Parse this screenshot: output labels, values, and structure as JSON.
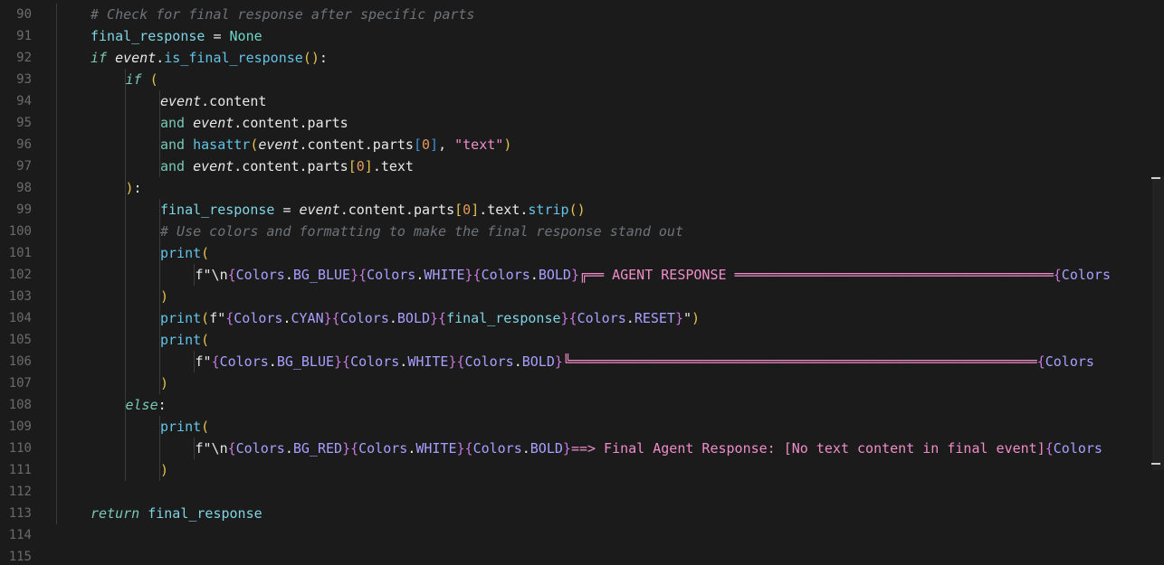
{
  "editor": {
    "lines": [
      {
        "num": "90",
        "indent": 1,
        "tokens": [
          [
            "comment",
            "# Check for final response after specific parts"
          ]
        ]
      },
      {
        "num": "91",
        "indent": 1,
        "tokens": [
          [
            "var",
            "final_response"
          ],
          [
            "op",
            " = "
          ],
          [
            "bool",
            "None"
          ]
        ]
      },
      {
        "num": "92",
        "indent": 1,
        "tokens": [
          [
            "kw",
            "if"
          ],
          [
            "op",
            " "
          ],
          [
            "it",
            "event"
          ],
          [
            "op",
            "."
          ],
          [
            "func",
            "is_final_response"
          ],
          [
            "paren",
            "()"
          ],
          [
            "op",
            ":"
          ]
        ]
      },
      {
        "num": "93",
        "indent": 2,
        "tokens": [
          [
            "kw",
            "if"
          ],
          [
            "op",
            " "
          ],
          [
            "paren",
            "("
          ]
        ]
      },
      {
        "num": "94",
        "indent": 3,
        "tokens": [
          [
            "it",
            "event"
          ],
          [
            "op",
            ".content"
          ]
        ]
      },
      {
        "num": "95",
        "indent": 3,
        "tokens": [
          [
            "kwp",
            "and"
          ],
          [
            "op",
            " "
          ],
          [
            "it",
            "event"
          ],
          [
            "op",
            ".content.parts"
          ]
        ]
      },
      {
        "num": "96",
        "indent": 3,
        "tokens": [
          [
            "kwp",
            "and"
          ],
          [
            "op",
            " "
          ],
          [
            "func",
            "hasattr"
          ],
          [
            "paren",
            "("
          ],
          [
            "it",
            "event"
          ],
          [
            "op",
            ".content.parts"
          ],
          [
            "bracket",
            "["
          ],
          [
            "num",
            "0"
          ],
          [
            "bracket",
            "]"
          ],
          [
            "op",
            ", "
          ],
          [
            "str",
            "\"text\""
          ],
          [
            "paren",
            ")"
          ]
        ]
      },
      {
        "num": "97",
        "indent": 3,
        "tokens": [
          [
            "kwp",
            "and"
          ],
          [
            "op",
            " "
          ],
          [
            "it",
            "event"
          ],
          [
            "op",
            ".content.parts"
          ],
          [
            "paren",
            "["
          ],
          [
            "num",
            "0"
          ],
          [
            "paren",
            "]"
          ],
          [
            "op",
            ".text"
          ]
        ]
      },
      {
        "num": "98",
        "indent": 2,
        "tokens": [
          [
            "paren",
            ")"
          ],
          [
            "op",
            ":"
          ]
        ]
      },
      {
        "num": "99",
        "indent": 3,
        "tokens": [
          [
            "var",
            "final_response"
          ],
          [
            "op",
            " = "
          ],
          [
            "it",
            "event"
          ],
          [
            "op",
            ".content.parts"
          ],
          [
            "paren",
            "["
          ],
          [
            "num",
            "0"
          ],
          [
            "paren",
            "]"
          ],
          [
            "op",
            ".text."
          ],
          [
            "func",
            "strip"
          ],
          [
            "paren",
            "()"
          ]
        ]
      },
      {
        "num": "100",
        "indent": 3,
        "tokens": [
          [
            "comment",
            "# Use colors and formatting to make the final response stand out"
          ]
        ]
      },
      {
        "num": "101",
        "indent": 3,
        "tokens": [
          [
            "func",
            "print"
          ],
          [
            "paren",
            "("
          ]
        ]
      },
      {
        "num": "102",
        "indent": 4,
        "tokens": [
          [
            "op",
            "f\"\\n"
          ],
          [
            "brace",
            "{"
          ],
          [
            "cls",
            "Colors"
          ],
          [
            "op",
            "."
          ],
          [
            "cls",
            "BG_BLUE"
          ],
          [
            "brace",
            "}{"
          ],
          [
            "cls",
            "Colors"
          ],
          [
            "op",
            "."
          ],
          [
            "cls",
            "WHITE"
          ],
          [
            "brace",
            "}{"
          ],
          [
            "cls",
            "Colors"
          ],
          [
            "op",
            "."
          ],
          [
            "cls",
            "BOLD"
          ],
          [
            "brace",
            "}"
          ],
          [
            "str",
            "╔══ AGENT RESPONSE ═══════════════════════════════════════"
          ],
          [
            "brace",
            "{"
          ],
          [
            "cls",
            "Colors"
          ]
        ]
      },
      {
        "num": "103",
        "indent": 3,
        "tokens": [
          [
            "paren",
            ")"
          ]
        ]
      },
      {
        "num": "104",
        "indent": 3,
        "tokens": [
          [
            "func",
            "print"
          ],
          [
            "paren",
            "("
          ],
          [
            "op",
            "f\""
          ],
          [
            "brace",
            "{"
          ],
          [
            "cls",
            "Colors"
          ],
          [
            "op",
            "."
          ],
          [
            "cls",
            "CYAN"
          ],
          [
            "brace",
            "}{"
          ],
          [
            "cls",
            "Colors"
          ],
          [
            "op",
            "."
          ],
          [
            "cls",
            "BOLD"
          ],
          [
            "brace",
            "}{"
          ],
          [
            "var",
            "final_response"
          ],
          [
            "brace",
            "}{"
          ],
          [
            "cls",
            "Colors"
          ],
          [
            "op",
            "."
          ],
          [
            "cls",
            "RESET"
          ],
          [
            "brace",
            "}"
          ],
          [
            "op",
            "\""
          ],
          [
            "paren",
            ")"
          ]
        ]
      },
      {
        "num": "105",
        "indent": 3,
        "tokens": [
          [
            "func",
            "print"
          ],
          [
            "paren",
            "("
          ]
        ]
      },
      {
        "num": "106",
        "indent": 4,
        "tokens": [
          [
            "op",
            "f\""
          ],
          [
            "brace",
            "{"
          ],
          [
            "cls",
            "Colors"
          ],
          [
            "op",
            "."
          ],
          [
            "cls",
            "BG_BLUE"
          ],
          [
            "brace",
            "}{"
          ],
          [
            "cls",
            "Colors"
          ],
          [
            "op",
            "."
          ],
          [
            "cls",
            "WHITE"
          ],
          [
            "brace",
            "}{"
          ],
          [
            "cls",
            "Colors"
          ],
          [
            "op",
            "."
          ],
          [
            "cls",
            "BOLD"
          ],
          [
            "brace",
            "}"
          ],
          [
            "str",
            "╚═════════════════════════════════════════════════════════"
          ],
          [
            "brace",
            "{"
          ],
          [
            "cls",
            "Colors"
          ]
        ]
      },
      {
        "num": "107",
        "indent": 3,
        "tokens": [
          [
            "paren",
            ")"
          ]
        ]
      },
      {
        "num": "108",
        "indent": 2,
        "tokens": [
          [
            "kw",
            "else"
          ],
          [
            "op",
            ":"
          ]
        ]
      },
      {
        "num": "109",
        "indent": 3,
        "tokens": [
          [
            "func",
            "print"
          ],
          [
            "paren",
            "("
          ]
        ]
      },
      {
        "num": "110",
        "indent": 4,
        "tokens": [
          [
            "op",
            "f\"\\n"
          ],
          [
            "brace",
            "{"
          ],
          [
            "cls",
            "Colors"
          ],
          [
            "op",
            "."
          ],
          [
            "cls",
            "BG_RED"
          ],
          [
            "brace",
            "}{"
          ],
          [
            "cls",
            "Colors"
          ],
          [
            "op",
            "."
          ],
          [
            "cls",
            "WHITE"
          ],
          [
            "brace",
            "}{"
          ],
          [
            "cls",
            "Colors"
          ],
          [
            "op",
            "."
          ],
          [
            "cls",
            "BOLD"
          ],
          [
            "brace",
            "}"
          ],
          [
            "str",
            "==> Final Agent Response: [No text content in final event]"
          ],
          [
            "brace",
            "{"
          ],
          [
            "cls",
            "Colors"
          ]
        ]
      },
      {
        "num": "111",
        "indent": 3,
        "tokens": [
          [
            "paren",
            ")"
          ]
        ]
      },
      {
        "num": "112",
        "indent": 0,
        "tokens": []
      },
      {
        "num": "113",
        "indent": 1,
        "tokens": [
          [
            "kw",
            "return"
          ],
          [
            "op",
            " "
          ],
          [
            "var",
            "final_response"
          ]
        ]
      },
      {
        "num": "114",
        "indent": 0,
        "tokens": []
      },
      {
        "num": "115",
        "indent": 0,
        "tokens": []
      }
    ]
  }
}
